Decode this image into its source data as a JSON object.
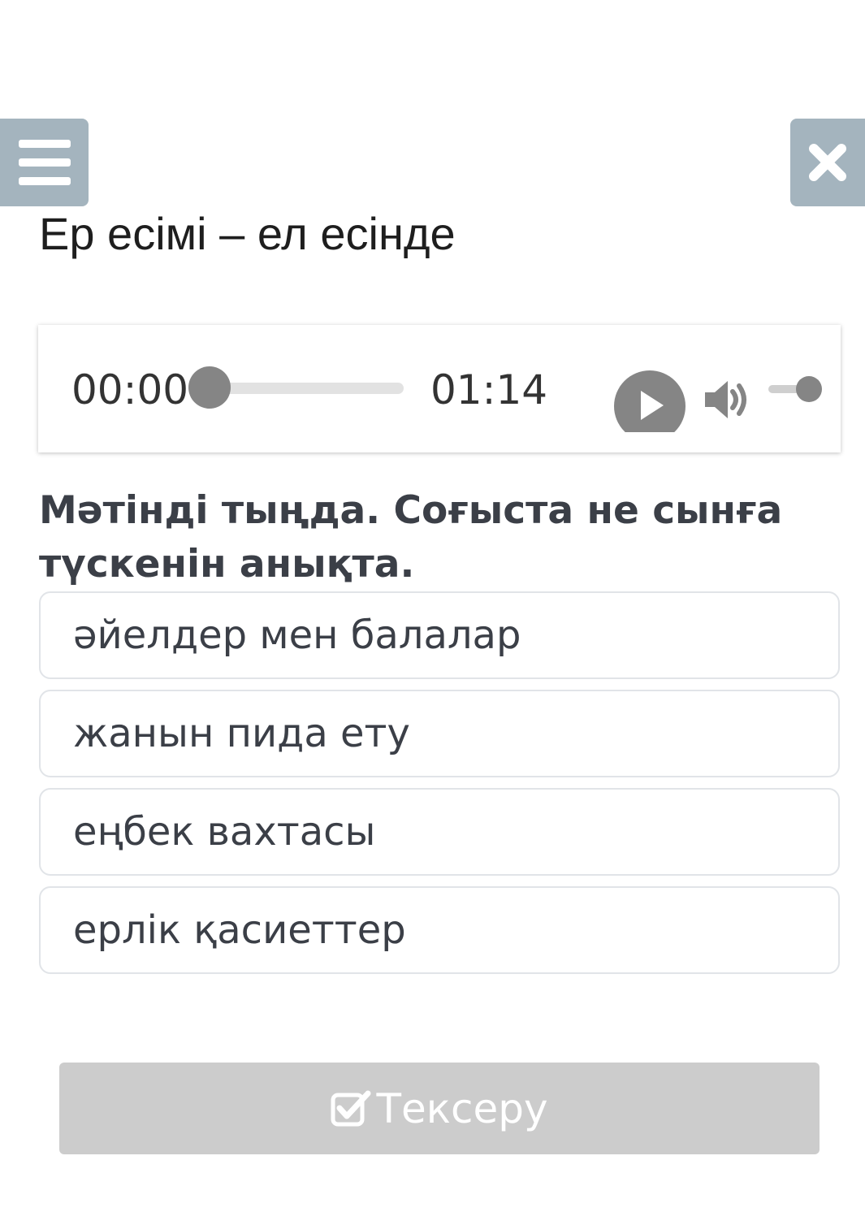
{
  "header": {
    "menu_icon": "hamburger-menu-icon",
    "close_icon": "close-icon"
  },
  "page": {
    "title": "Ер есімі – ел есінде"
  },
  "audio": {
    "current_time": "00:00",
    "total_time": "01:14",
    "progress": 0,
    "volume": 1.0,
    "play_icon": "play-icon",
    "volume_icon": "volume-icon"
  },
  "question": {
    "text": "Мәтінді тыңда. Соғыста не сынға түскенін анықта."
  },
  "options": [
    {
      "label": "әйелдер мен балалар"
    },
    {
      "label": "жанын пида ету"
    },
    {
      "label": "еңбек вахтасы"
    },
    {
      "label": "ерлік қасиеттер"
    }
  ],
  "submit": {
    "label": "Тексеру",
    "icon": "checkbox-check-icon",
    "state": "disabled"
  },
  "colors": {
    "side_button_bg": "#a4b4be",
    "player_control": "#858585",
    "question_text": "#3b3f47",
    "option_border": "#e1e4e8",
    "submit_disabled_bg": "#cccccc"
  }
}
